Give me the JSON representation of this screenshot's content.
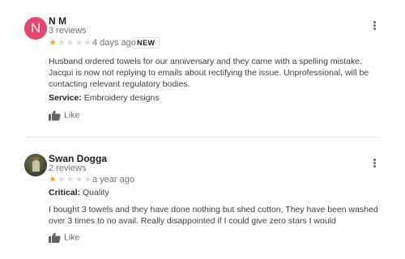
{
  "reviews": [
    {
      "avatar_letter": "N",
      "avatar_color": "#e8446e",
      "name": "N M",
      "review_count": "3 reviews",
      "rating": 1,
      "stars_on": "★",
      "stars_off": "★★★★",
      "date": "4 days ago",
      "badge": "NEW",
      "text": "Husband ordered towels for our anniversary and they came with a spelling mistake. Jacqui is now not replying to emails about rectifying the issue. Unprofessional, will be contacting relevant regulatory bodies.",
      "meta_label": "Service:",
      "meta_value": "Embroidery designs",
      "like_label": "Like"
    },
    {
      "name": "Swan Dogga",
      "review_count": "2 reviews",
      "rating": 1,
      "stars_on": "★",
      "stars_off": "★★★★",
      "date": "a year ago",
      "meta_label": "Critical:",
      "meta_value": "Quality",
      "text": "I bought 3 towels and they have done nothing but shed cotton, They have been washed over 3 times to no avail. Really disappointed if I could give zero stars I would",
      "like_label": "Like"
    }
  ],
  "colors": {
    "star": "#f5a623",
    "star_empty": "#dadce0",
    "badge_border": "#dadce0"
  }
}
